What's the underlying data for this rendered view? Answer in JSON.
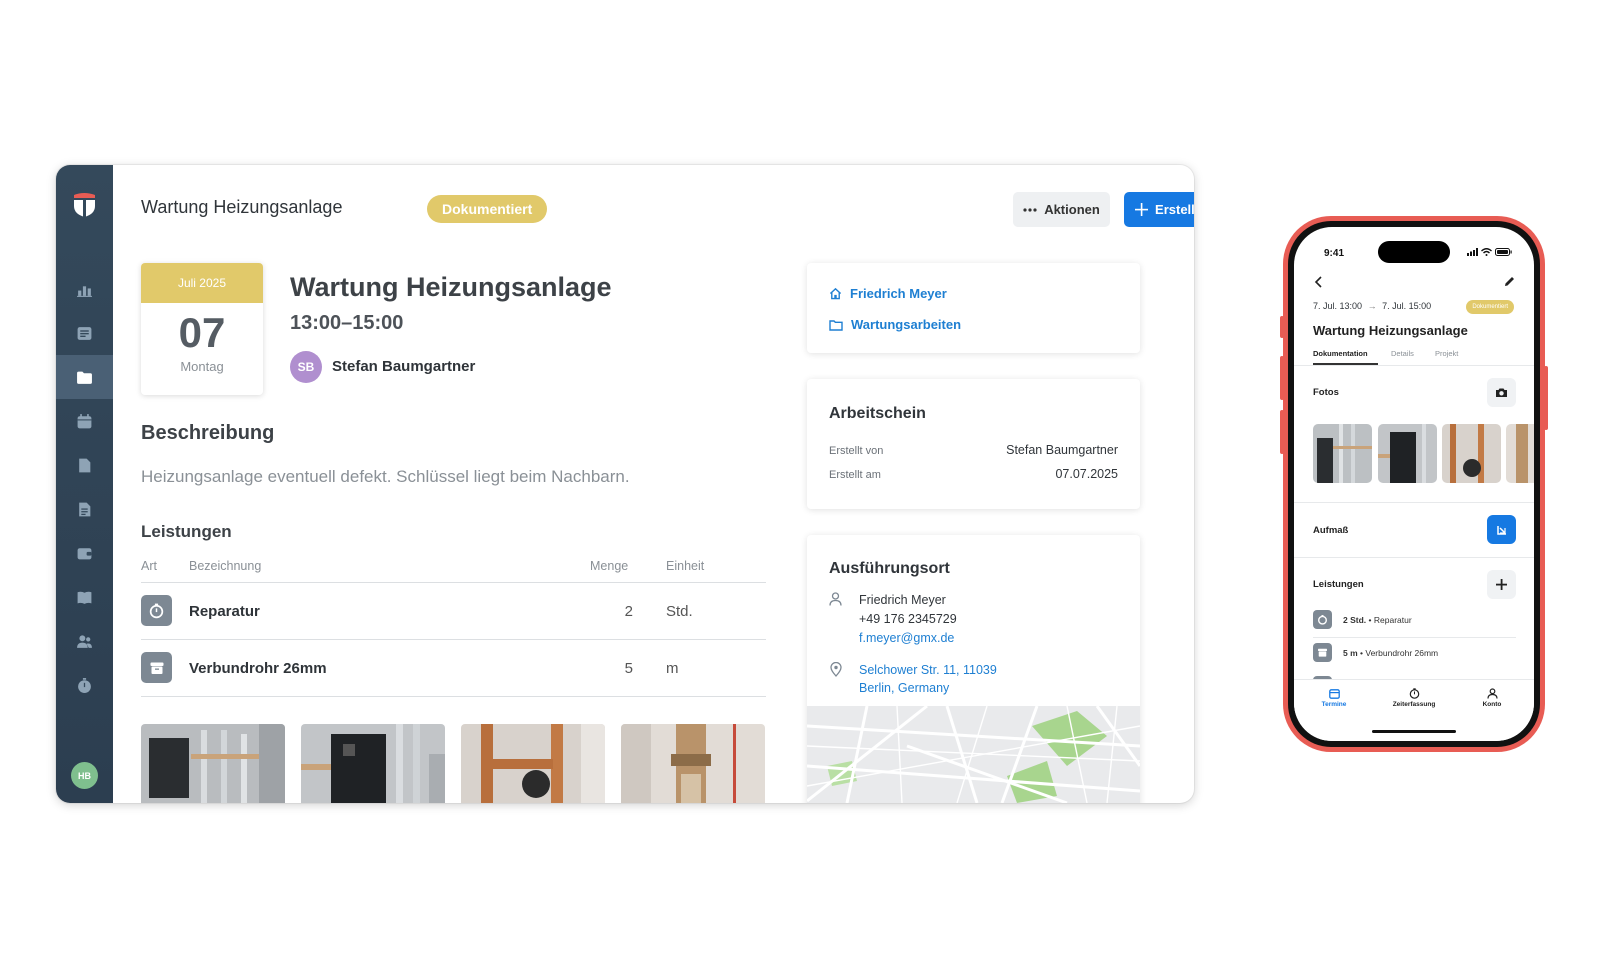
{
  "desktop": {
    "header": {
      "title": "Wartung Heizungsanlage",
      "status": "Dokumentiert",
      "actions_label": "Aktionen",
      "create_label": "Erstellen"
    },
    "sidebar": {
      "items": [
        "chart-icon",
        "list-icon",
        "folder-icon",
        "calendar-icon",
        "document-icon",
        "invoice-icon",
        "wallet-icon",
        "book-icon",
        "users-icon",
        "timer-icon"
      ],
      "active_index": 2,
      "user_initials": "HB"
    },
    "date_card": {
      "month": "Juli 2025",
      "day": "07",
      "weekday": "Montag"
    },
    "appointment": {
      "title": "Wartung Heizungsanlage",
      "time": "13:00–15:00",
      "assignee_initials": "SB",
      "assignee_name": "Stefan Baumgartner"
    },
    "description": {
      "heading": "Beschreibung",
      "text": "Heizungsanlage eventuell defekt. Schlüssel liegt beim Nachbarn."
    },
    "services": {
      "heading": "Leistungen",
      "columns": [
        "Art",
        "Bezeichnung",
        "Menge",
        "Einheit"
      ],
      "rows": [
        {
          "icon": "stopwatch-icon",
          "name": "Reparatur",
          "qty": "2",
          "unit": "Std."
        },
        {
          "icon": "archive-box-icon",
          "name": "Verbundrohr 26mm",
          "qty": "5",
          "unit": "m"
        }
      ]
    },
    "links_card": {
      "customer": "Friedrich Meyer",
      "project": "Wartungsarbeiten"
    },
    "worksheet": {
      "heading": "Arbeitschein",
      "created_by_label": "Erstellt von",
      "created_by": "Stefan Baumgartner",
      "created_at_label": "Erstellt am",
      "created_at": "07.07.2025"
    },
    "location": {
      "heading": "Ausführungsort",
      "name": "Friedrich Meyer",
      "phone": "+49 176 2345729",
      "email": "f.meyer@gmx.de",
      "address_line1": "Selchower Str. 11, 11039",
      "address_line2": "Berlin, Germany"
    },
    "colors": {
      "accent_blue": "#1679e2",
      "status_gold": "#e1c96a",
      "sidebar": "#2c3e50",
      "link": "#1e7fd2"
    }
  },
  "phone": {
    "status_time": "9:41",
    "dates": "7. Jul. 13:00",
    "dates_end": "7. Jul. 15:00",
    "badge": "Dokumentiert",
    "title": "Wartung Heizungsanlage",
    "tabs": [
      "Dokumentation",
      "Details",
      "Projekt"
    ],
    "photos_heading": "Fotos",
    "measure_heading": "Aufmaß",
    "services_heading": "Leistungen",
    "service_rows": [
      {
        "amount": "2 Std.",
        "name": "Reparatur"
      },
      {
        "amount": "5 m",
        "name": "Verbundrohr 26mm"
      }
    ],
    "nav": [
      "Termine",
      "Zeiterfassung",
      "Konto"
    ],
    "frame_color": "#e85c54"
  }
}
